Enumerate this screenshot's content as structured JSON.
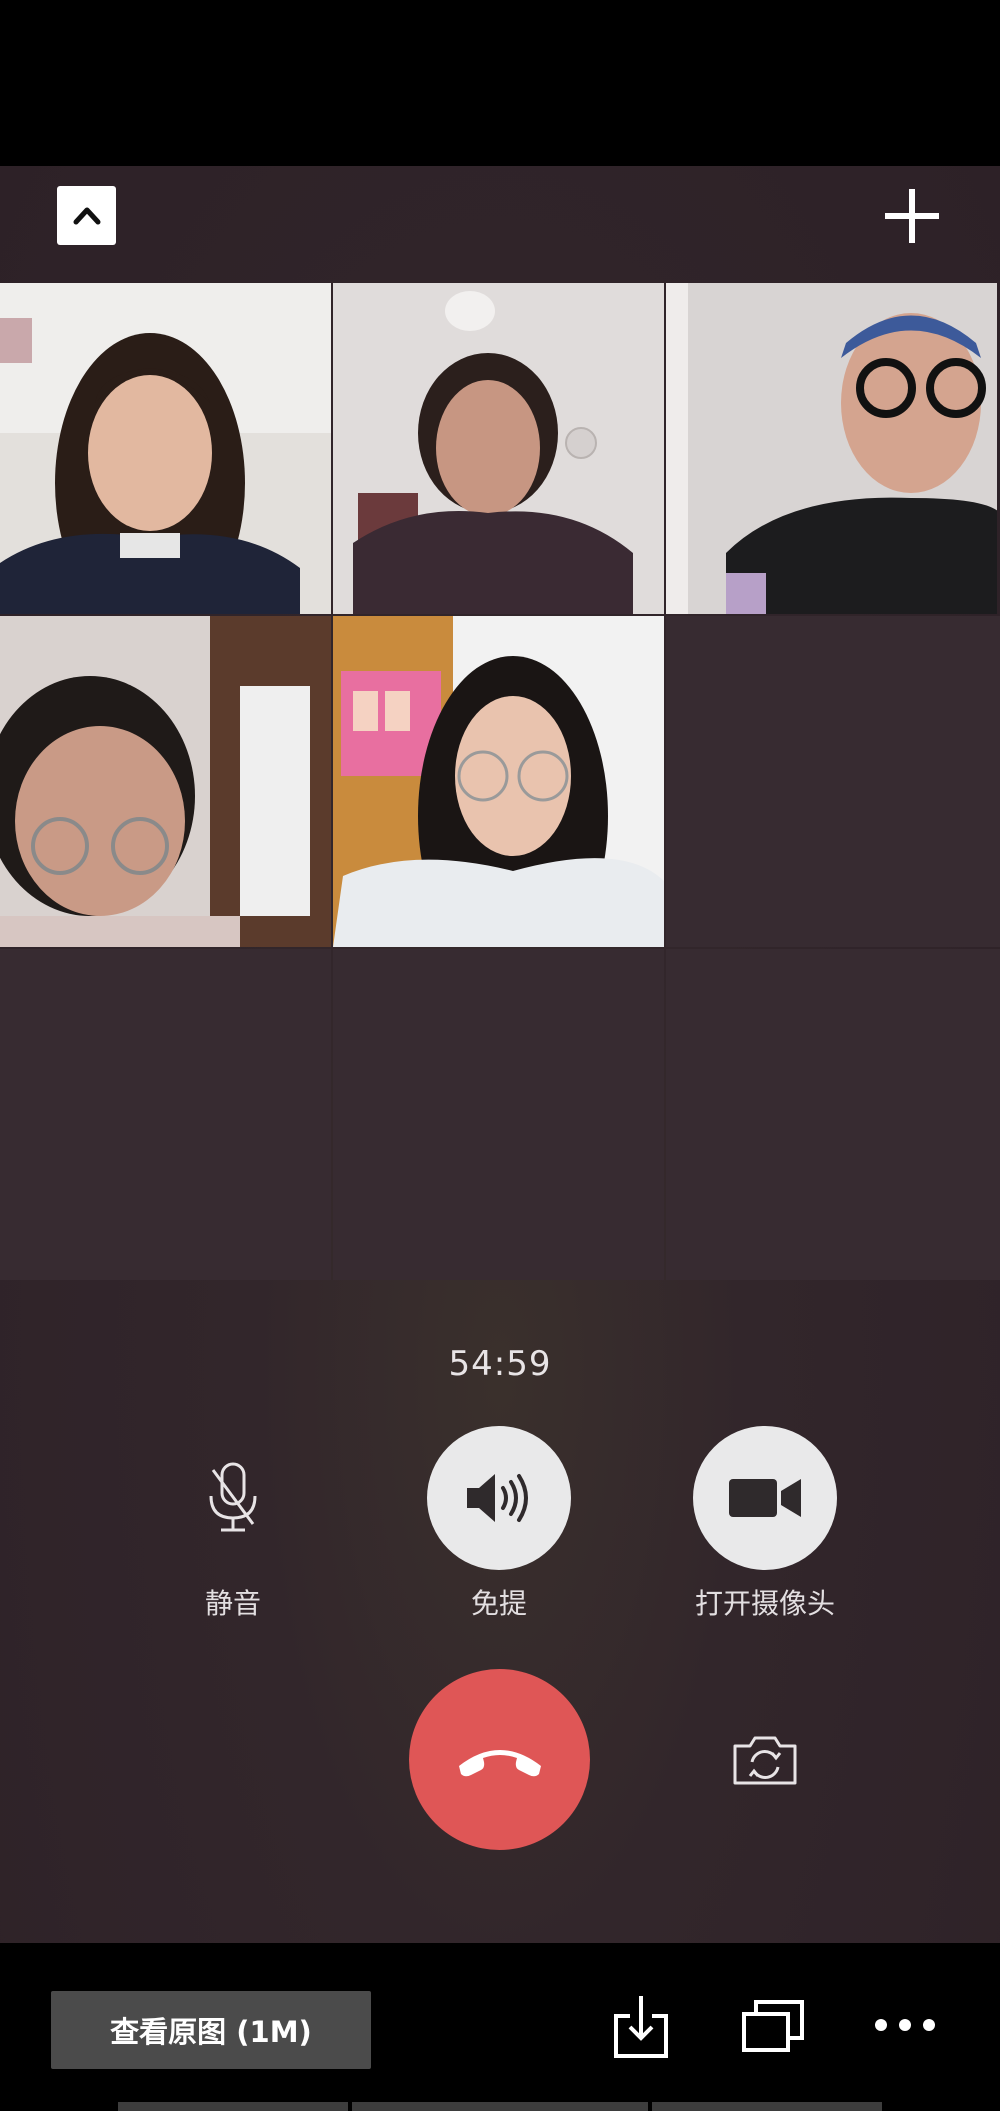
{
  "call": {
    "timer": "54:59",
    "controls": {
      "mute_label": "静音",
      "speaker_label": "免提",
      "camera_label": "打开摄像头"
    }
  },
  "viewer": {
    "view_original_label": "查看原图 (1M)"
  },
  "colors": {
    "call_background": "#2d2127",
    "hangup_red": "#df5656",
    "control_circle": "#e9e9ea"
  },
  "icons": [
    "chevron-up-icon",
    "plus-icon",
    "microphone-icon",
    "speaker-icon",
    "video-camera-icon",
    "phone-hangup-icon",
    "camera-switch-icon",
    "download-icon",
    "multi-window-icon",
    "more-icon"
  ]
}
